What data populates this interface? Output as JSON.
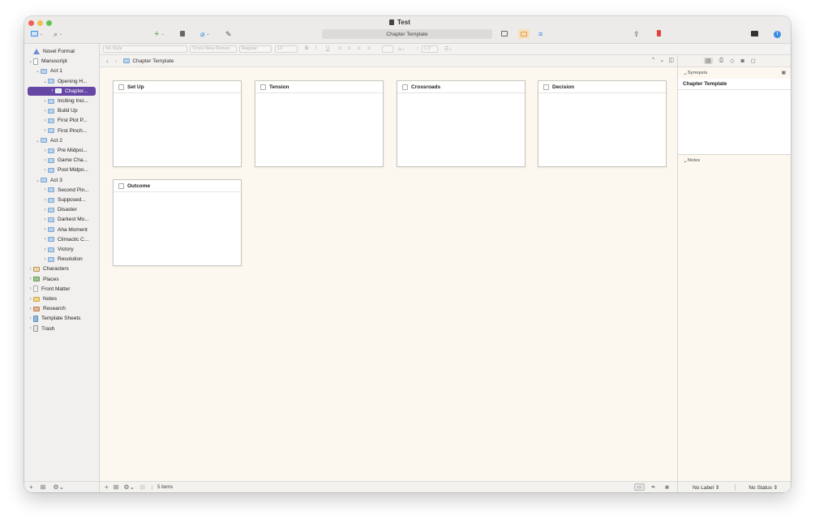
{
  "window": {
    "title": "Test"
  },
  "toolbar": {
    "center_title": "Chapter Template",
    "icons": [
      "sidebar-toggle-icon",
      "search-icon",
      "add-icon",
      "trash-icon",
      "attach-icon",
      "compose-icon",
      "corkboard-view-icon",
      "grid-view-icon",
      "outline-view-icon",
      "share-icon",
      "bookmark-icon",
      "compile-icon",
      "info-icon"
    ]
  },
  "format_bar": {
    "style": "No Style",
    "font": "Times New Roman",
    "weight": "Regular",
    "size": "12",
    "line_spacing": "1.0"
  },
  "sidebar": {
    "items": [
      {
        "label": "Novel Format",
        "level": 0,
        "icon": "format-icon",
        "expanded": false,
        "disclosure": false
      },
      {
        "label": "Manuscript",
        "level": 0,
        "icon": "manuscript-icon",
        "expanded": true,
        "disclosure": true
      },
      {
        "label": "Act 1",
        "level": 1,
        "icon": "folder-icon",
        "expanded": true,
        "disclosure": true
      },
      {
        "label": "Opening H...",
        "level": 2,
        "icon": "folder-icon",
        "expanded": true,
        "disclosure": true
      },
      {
        "label": "Chapter...",
        "level": 3,
        "icon": "folder-icon",
        "expanded": false,
        "disclosure": true,
        "selected": true
      },
      {
        "label": "Inciting Inci...",
        "level": 2,
        "icon": "folder-icon",
        "expanded": false,
        "disclosure": true
      },
      {
        "label": "Build Up",
        "level": 2,
        "icon": "folder-icon",
        "expanded": false,
        "disclosure": true
      },
      {
        "label": "First Plot P...",
        "level": 2,
        "icon": "folder-icon",
        "expanded": false,
        "disclosure": true
      },
      {
        "label": "First Pinch...",
        "level": 2,
        "icon": "folder-icon",
        "expanded": false,
        "disclosure": true
      },
      {
        "label": "Act 2",
        "level": 1,
        "icon": "folder-icon",
        "expanded": true,
        "disclosure": true
      },
      {
        "label": "Pre Midpoi...",
        "level": 2,
        "icon": "folder-icon",
        "expanded": false,
        "disclosure": true
      },
      {
        "label": "Game Cha...",
        "level": 2,
        "icon": "folder-icon",
        "expanded": false,
        "disclosure": true
      },
      {
        "label": "Post Midpo...",
        "level": 2,
        "icon": "folder-icon",
        "expanded": false,
        "disclosure": true
      },
      {
        "label": "Act 3",
        "level": 1,
        "icon": "folder-icon",
        "expanded": true,
        "disclosure": true
      },
      {
        "label": "Second Pin...",
        "level": 2,
        "icon": "folder-icon",
        "expanded": false,
        "disclosure": true
      },
      {
        "label": "Supposed...",
        "level": 2,
        "icon": "folder-icon",
        "expanded": false,
        "disclosure": true
      },
      {
        "label": "Disaster",
        "level": 2,
        "icon": "folder-icon",
        "expanded": false,
        "disclosure": true
      },
      {
        "label": "Darkest Mo...",
        "level": 2,
        "icon": "folder-icon",
        "expanded": false,
        "disclosure": true
      },
      {
        "label": "Aha Moment",
        "level": 2,
        "icon": "folder-icon",
        "expanded": false,
        "disclosure": true
      },
      {
        "label": "Climactic C...",
        "level": 2,
        "icon": "folder-icon",
        "expanded": false,
        "disclosure": true
      },
      {
        "label": "Victory",
        "level": 2,
        "icon": "folder-icon",
        "expanded": false,
        "disclosure": true
      },
      {
        "label": "Resolution",
        "level": 2,
        "icon": "folder-icon",
        "expanded": false,
        "disclosure": true
      },
      {
        "label": "Characters",
        "level": 0,
        "icon": "characters-icon",
        "expanded": false,
        "disclosure": true
      },
      {
        "label": "Places",
        "level": 0,
        "icon": "places-icon",
        "expanded": false,
        "disclosure": true
      },
      {
        "label": "Front Matter",
        "level": 0,
        "icon": "front-matter-icon",
        "expanded": false,
        "disclosure": true
      },
      {
        "label": "Notes",
        "level": 0,
        "icon": "notes-icon",
        "expanded": false,
        "disclosure": true
      },
      {
        "label": "Research",
        "level": 0,
        "icon": "research-icon",
        "expanded": false,
        "disclosure": true
      },
      {
        "label": "Template Sheets",
        "level": 0,
        "icon": "template-sheets-icon",
        "expanded": false,
        "disclosure": true
      },
      {
        "label": "Trash",
        "level": 0,
        "icon": "trash-icon",
        "expanded": false,
        "disclosure": true
      }
    ]
  },
  "main": {
    "breadcrumb": "Chapter Template",
    "cards": [
      {
        "title": "Set Up"
      },
      {
        "title": "Tension"
      },
      {
        "title": "Crossroads"
      },
      {
        "title": "Decision"
      },
      {
        "title": "Outcome"
      }
    ],
    "item_count": "5 items"
  },
  "inspector": {
    "synopsis_label": "Synopsis",
    "synopsis_title": "Chapter Template",
    "notes_label": "Notes",
    "label_select": "No Label",
    "status_select": "No Status"
  },
  "colors": {
    "selection": "#6747a5",
    "corkboard_bg": "#fcf8f0",
    "accent_blue": "#3a8ee6",
    "bookmark_red": "#e0443e",
    "grid_orange": "#e89a3c"
  }
}
